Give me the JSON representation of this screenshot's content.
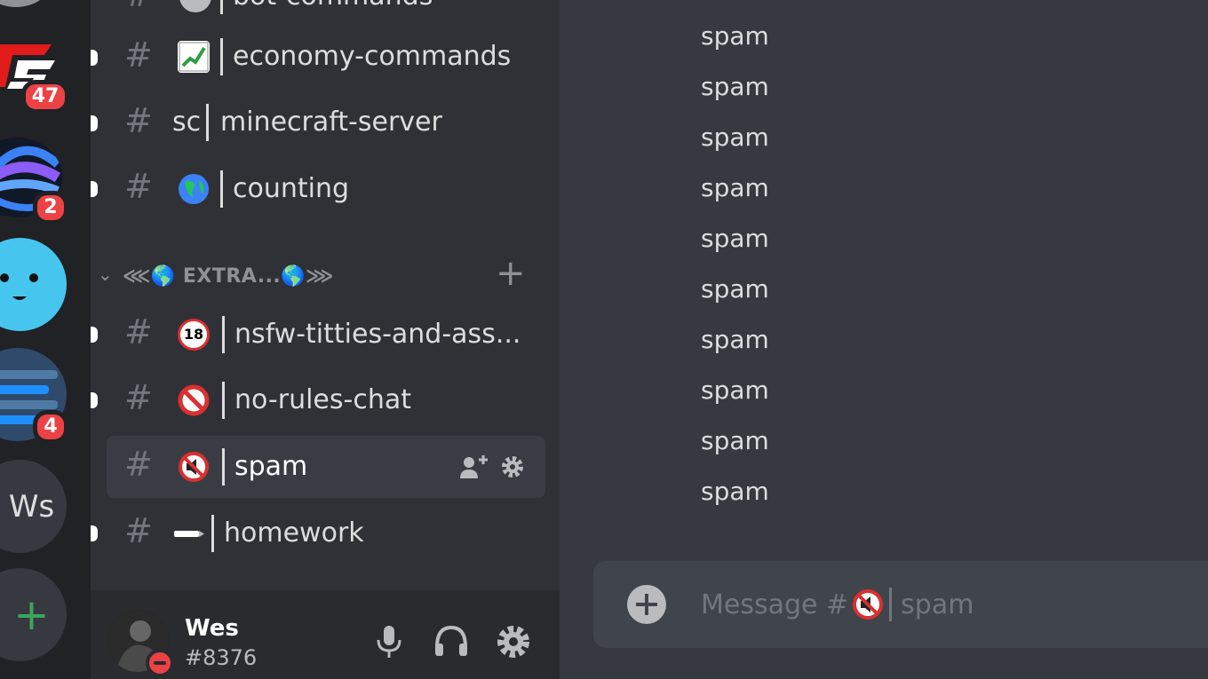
{
  "servers": [
    {
      "name": "server-top",
      "badge": ""
    },
    {
      "name": "server-ts",
      "badge": "47"
    },
    {
      "name": "server-blue",
      "badge": "2"
    },
    {
      "name": "server-face",
      "badge": ""
    },
    {
      "name": "server-list",
      "badge": "4"
    },
    {
      "name": "server-ws",
      "label": "Ws",
      "badge": ""
    },
    {
      "name": "add-server",
      "label": "+",
      "badge": ""
    }
  ],
  "channels": {
    "partial_top": "bot-commands",
    "items": [
      {
        "prefix": "",
        "name": "economy-commands",
        "icon": "chart-increasing-icon"
      },
      {
        "prefix": "sc",
        "name": "minecraft-server",
        "icon": ""
      },
      {
        "prefix": "",
        "name": "counting",
        "icon": "globe-icon"
      }
    ],
    "category": {
      "label": "⋘🌎 EXTRA...🌎⋙"
    },
    "extra_items": [
      {
        "name": "nsfw-titties-and-ass...",
        "icon": "no-under-18-icon"
      },
      {
        "name": "no-rules-chat",
        "icon": "prohibited-icon"
      },
      {
        "name": "spam",
        "icon": "muted-speaker-icon",
        "active": true
      },
      {
        "name": "homework",
        "icon": "pen-icon"
      }
    ]
  },
  "user": {
    "name": "Wes",
    "tag": "#8376"
  },
  "messages": [
    "spam",
    "spam",
    "spam",
    "spam",
    "spam",
    "spam",
    "spam",
    "spam",
    "spam",
    "spam"
  ],
  "composer": {
    "placeholder_prefix": "Message #",
    "placeholder_channel": "spam"
  },
  "colors": {
    "accent_red": "#ed4245",
    "add_green": "#3ba55d",
    "sidebar": "#2f3136",
    "chat": "#36393f"
  }
}
